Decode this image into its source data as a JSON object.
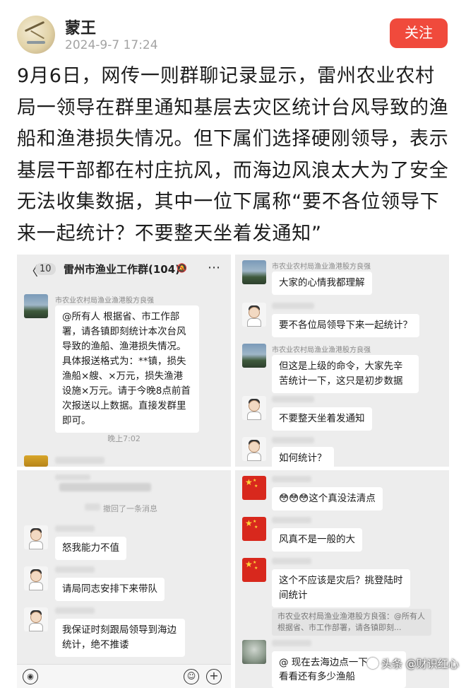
{
  "post": {
    "author": "蒙王",
    "time": "2024-9-7 17:24",
    "follow_label": "关注",
    "text_lines": [
      "9月6日，网传一则群聊记录显示，雷州农业农村",
      "局一领导在群里通知基层去灾区统计台风导致的渔",
      "船和渔港损失情况。但下属们选择硬刚领导，表示",
      "基层干部都在村庄抗风，而海边风浪太大为了安全",
      "无法收集数据，其中一位下属称“要不各位领导下",
      "来一起统计？不要整天坐着发通知”"
    ]
  },
  "panel1": {
    "back": "〈",
    "unread": "10",
    "group_title": "雷州市渔业工作群(104)",
    "mute_icon": "🔕",
    "more_icon": "⋯",
    "sender": "市农业农村局渔业渔港股方良强",
    "message": "@所有人  根据省、市工作部署，请各镇即刻统计本次台风导致的渔船、渔港损失情况。具体报送格式为：**镇，损失渔船×艘、×万元，损失渔港设施×万元。请于今晚8点前首次报送以上数据。直接发群里即可。",
    "time": "晚上7:02"
  },
  "panel2": {
    "sender1": "市农业农村局渔业渔港股方良强",
    "msg1": "大家的心情我都理解",
    "msg2": "要不各位局领导下来一起统计？",
    "sender2": "市农业农村局渔业渔港股方良强",
    "msg3": "但这是上级的命令，大家先辛苦统计一下，这只是初步数据",
    "msg4": "不要整天坐着发通知",
    "msg5": "如何统计？"
  },
  "panel3": {
    "recall": "撤回了一条消息",
    "msg1": "怒我能力不值",
    "msg2": "请局同志安排下来带队",
    "msg3": "我保证时刻跟局领导到海边统计，绝不推诿",
    "voice_icon": "◉",
    "emoji_icon": "☺",
    "plus_icon": "+"
  },
  "panel4": {
    "msg1": "😳😳😳这个真没法清点",
    "msg2": "风真不是一般的大",
    "msg3": "这个不应该是灾后？挑登陆时间统计",
    "quote": "市农业农村局渔业渔港股方良强：@所有人  根据省、市工作部署，请各镇即刻...",
    "msg4_line1": "@        现在去海边点一下",
    "msg4_line2": "看看还有多少渔船"
  },
  "watermark": "头条 @财识红心"
}
